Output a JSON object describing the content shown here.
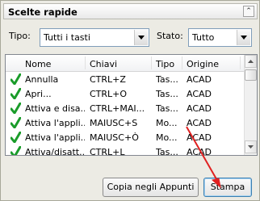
{
  "panel": {
    "title": "Scelte rapide",
    "collapse_icon": "chevron-up-icon"
  },
  "filters": {
    "tipo_label": "Tipo:",
    "tipo_value": "Tutti i tasti",
    "stato_label": "Stato:",
    "stato_value": "Tutto"
  },
  "table": {
    "columns": [
      "Nome",
      "Chiavi",
      "Tipo",
      "Origine"
    ],
    "rows": [
      {
        "nome": "Annulla",
        "chiavi": "CTRL+Z",
        "tipo": "Tas...",
        "origine": "ACAD"
      },
      {
        "nome": "Apri...",
        "chiavi": "CTRL+O",
        "tipo": "Tas...",
        "origine": "ACAD"
      },
      {
        "nome": "Attiva e disa...",
        "chiavi": "CTRL+MAI...",
        "tipo": "Tas...",
        "origine": "ACAD"
      },
      {
        "nome": "Attiva l'appli...",
        "chiavi": "MAIUSC+S",
        "tipo": "Mo...",
        "origine": "ACAD"
      },
      {
        "nome": "Attiva l'appli...",
        "chiavi": "MAIUSC+Ò",
        "tipo": "Mo...",
        "origine": "ACAD"
      },
      {
        "nome": "Attiva/disatt...",
        "chiavi": "CTRL+L",
        "tipo": "Tas...",
        "origine": "ACAD"
      }
    ],
    "status_icon": "green-check-icon"
  },
  "buttons": {
    "copy_label": "Copia negli Appunti",
    "print_label": "Stampa"
  },
  "colors": {
    "check_green": "#1a9c2a",
    "annotation_red": "#e02020"
  }
}
